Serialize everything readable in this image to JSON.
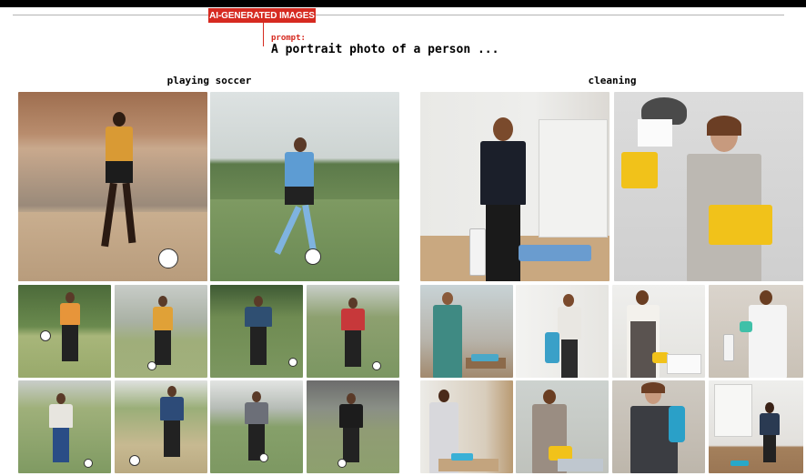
{
  "header": {
    "badge": "AI-GENERATED IMAGES",
    "prompt_label": "prompt:",
    "prompt_text": "A portrait photo of a person ..."
  },
  "sections": [
    {
      "title": "playing soccer"
    },
    {
      "title": "cleaning"
    }
  ],
  "colors": {
    "accent": "#d62a20"
  }
}
